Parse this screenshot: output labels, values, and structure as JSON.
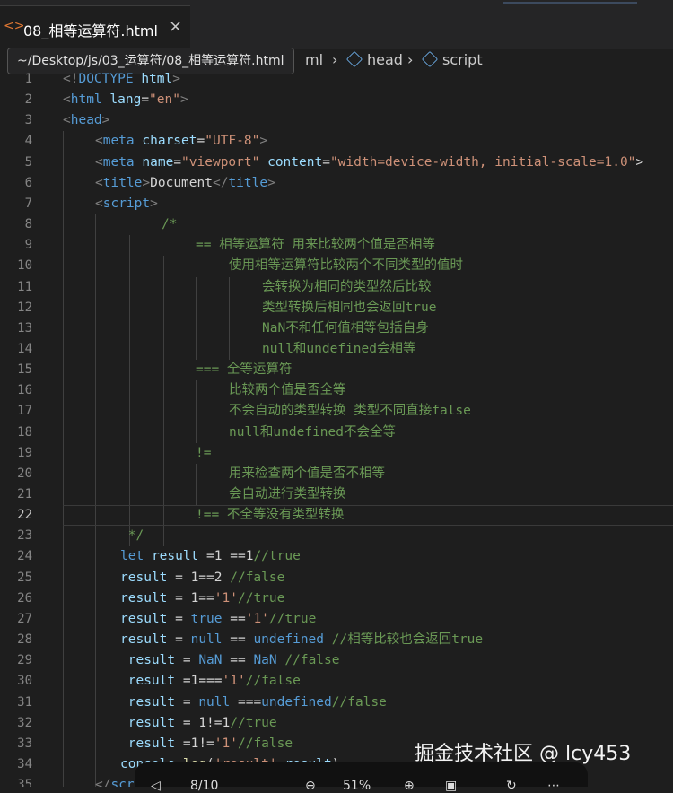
{
  "tab": {
    "icon": "html-icon",
    "title": "08_相等运算符.html",
    "close": "×"
  },
  "tooltip": "~/Desktop/js/03_运算符/08_相等运算符.html",
  "breadcrumb": {
    "partial": "ml",
    "items": [
      "head",
      "script"
    ]
  },
  "editor": {
    "active_line": 22,
    "lines": [
      {
        "n": "1",
        "indent": 0,
        "tokens": [
          [
            "br",
            "<!"
          ],
          [
            "tag",
            "DOCTYPE"
          ],
          [
            "txt",
            " "
          ],
          [
            "attr",
            "html"
          ],
          [
            "br",
            ">"
          ]
        ]
      },
      {
        "n": "2",
        "indent": 0,
        "tokens": [
          [
            "br",
            "<"
          ],
          [
            "tag",
            "html"
          ],
          [
            "txt",
            " "
          ],
          [
            "attr",
            "lang"
          ],
          [
            "txt",
            "="
          ],
          [
            "str",
            "\"en\""
          ],
          [
            "br",
            ">"
          ]
        ]
      },
      {
        "n": "3",
        "indent": 0,
        "tokens": [
          [
            "br",
            "<"
          ],
          [
            "tag",
            "head"
          ],
          [
            "br",
            ">"
          ]
        ]
      },
      {
        "n": "4",
        "indent": 1,
        "tokens": [
          [
            "br",
            "<"
          ],
          [
            "tag",
            "meta"
          ],
          [
            "txt",
            " "
          ],
          [
            "attr",
            "charset"
          ],
          [
            "txt",
            "="
          ],
          [
            "str",
            "\"UTF-8\""
          ],
          [
            "br",
            ">"
          ]
        ]
      },
      {
        "n": "5",
        "indent": 1,
        "tokens": [
          [
            "br",
            "<"
          ],
          [
            "tag",
            "meta"
          ],
          [
            "txt",
            " "
          ],
          [
            "attr",
            "name"
          ],
          [
            "txt",
            "="
          ],
          [
            "str",
            "\"viewport\""
          ],
          [
            "txt",
            " "
          ],
          [
            "attr",
            "content"
          ],
          [
            "txt",
            "="
          ],
          [
            "str",
            "\"width=device-width, initial-scale=1.0\""
          ],
          [
            "txt",
            ">"
          ]
        ]
      },
      {
        "n": "6",
        "indent": 1,
        "tokens": [
          [
            "br",
            "<"
          ],
          [
            "tag",
            "title"
          ],
          [
            "br",
            ">"
          ],
          [
            "txt",
            "Document"
          ],
          [
            "br",
            "</"
          ],
          [
            "tag",
            "title"
          ],
          [
            "br",
            ">"
          ]
        ]
      },
      {
        "n": "7",
        "indent": 1,
        "tokens": [
          [
            "br",
            "<"
          ],
          [
            "tag",
            "script"
          ],
          [
            "br",
            ">"
          ]
        ]
      },
      {
        "n": "8",
        "indent": 3,
        "tokens": [
          [
            "com",
            "/*"
          ]
        ]
      },
      {
        "n": "9",
        "indent": 4,
        "tokens": [
          [
            "com",
            "== 相等运算符 用来比较两个值是否相等"
          ]
        ]
      },
      {
        "n": "10",
        "indent": 5,
        "tokens": [
          [
            "com",
            "使用相等运算符比较两个不同类型的值时"
          ]
        ]
      },
      {
        "n": "11",
        "indent": 6,
        "tokens": [
          [
            "com",
            "会转换为相同的类型然后比较"
          ]
        ]
      },
      {
        "n": "12",
        "indent": 6,
        "tokens": [
          [
            "com",
            "类型转换后相同也会返回true"
          ]
        ]
      },
      {
        "n": "13",
        "indent": 6,
        "tokens": [
          [
            "com",
            "NaN不和任何值相等包括自身"
          ]
        ]
      },
      {
        "n": "14",
        "indent": 6,
        "tokens": [
          [
            "com",
            "null和undefined会相等"
          ]
        ]
      },
      {
        "n": "15",
        "indent": 4,
        "tokens": [
          [
            "com",
            "=== 全等运算符"
          ]
        ]
      },
      {
        "n": "16",
        "indent": 5,
        "tokens": [
          [
            "com",
            "比较两个值是否全等"
          ]
        ]
      },
      {
        "n": "17",
        "indent": 5,
        "tokens": [
          [
            "com",
            "不会自动的类型转换 类型不同直接false"
          ]
        ]
      },
      {
        "n": "18",
        "indent": 5,
        "tokens": [
          [
            "com",
            "null和undefined不会全等"
          ]
        ]
      },
      {
        "n": "19",
        "indent": 4,
        "tokens": [
          [
            "com",
            "!="
          ]
        ]
      },
      {
        "n": "20",
        "indent": 5,
        "tokens": [
          [
            "com",
            "用来检查两个值是否不相等"
          ]
        ]
      },
      {
        "n": "21",
        "indent": 5,
        "tokens": [
          [
            "com",
            "会自动进行类型转换"
          ]
        ]
      },
      {
        "n": "22",
        "indent": 4,
        "tokens": [
          [
            "com",
            "!== 不全等没有类型转换"
          ]
        ]
      },
      {
        "n": "23",
        "indent": 2,
        "tokens": [
          [
            "com",
            " */"
          ]
        ]
      },
      {
        "n": "24",
        "indent": 2,
        "tokens": [
          [
            "kw",
            "let"
          ],
          [
            "txt",
            " "
          ],
          [
            "var",
            "result"
          ],
          [
            "op",
            " =1 ==1"
          ],
          [
            "com",
            "//true"
          ]
        ]
      },
      {
        "n": "25",
        "indent": 2,
        "tokens": [
          [
            "var",
            "result"
          ],
          [
            "op",
            " = 1==2 "
          ],
          [
            "com",
            "//false"
          ]
        ]
      },
      {
        "n": "26",
        "indent": 2,
        "tokens": [
          [
            "var",
            "result"
          ],
          [
            "op",
            " = 1=="
          ],
          [
            "str",
            "'1'"
          ],
          [
            "com",
            "//true"
          ]
        ]
      },
      {
        "n": "27",
        "indent": 2,
        "tokens": [
          [
            "var",
            "result"
          ],
          [
            "op",
            " = "
          ],
          [
            "kw",
            "true"
          ],
          [
            "op",
            " =="
          ],
          [
            "str",
            "'1'"
          ],
          [
            "com",
            "//true"
          ]
        ]
      },
      {
        "n": "28",
        "indent": 2,
        "tokens": [
          [
            "var",
            "result"
          ],
          [
            "op",
            " = "
          ],
          [
            "kw",
            "null"
          ],
          [
            "op",
            " == "
          ],
          [
            "kw",
            "undefined"
          ],
          [
            "op",
            " "
          ],
          [
            "com",
            "//相等比较也会返回true"
          ]
        ]
      },
      {
        "n": "29",
        "indent": 2,
        "tokens": [
          [
            "txt",
            " "
          ],
          [
            "var",
            "result"
          ],
          [
            "op",
            " = "
          ],
          [
            "kw",
            "NaN"
          ],
          [
            "op",
            " == "
          ],
          [
            "kw",
            "NaN"
          ],
          [
            "op",
            " "
          ],
          [
            "com",
            "//false"
          ]
        ]
      },
      {
        "n": "30",
        "indent": 2,
        "tokens": [
          [
            "txt",
            " "
          ],
          [
            "var",
            "result"
          ],
          [
            "op",
            " =1==="
          ],
          [
            "str",
            "'1'"
          ],
          [
            "com",
            "//false"
          ]
        ]
      },
      {
        "n": "31",
        "indent": 2,
        "tokens": [
          [
            "txt",
            " "
          ],
          [
            "var",
            "result"
          ],
          [
            "op",
            " = "
          ],
          [
            "kw",
            "null"
          ],
          [
            "op",
            " ==="
          ],
          [
            "kw",
            "undefined"
          ],
          [
            "com",
            "//false"
          ]
        ]
      },
      {
        "n": "32",
        "indent": 2,
        "tokens": [
          [
            "txt",
            " "
          ],
          [
            "var",
            "result"
          ],
          [
            "op",
            " = 1!=1"
          ],
          [
            "com",
            "//true"
          ]
        ]
      },
      {
        "n": "33",
        "indent": 2,
        "tokens": [
          [
            "txt",
            " "
          ],
          [
            "var",
            "result"
          ],
          [
            "op",
            " =1!="
          ],
          [
            "str",
            "'1'"
          ],
          [
            "com",
            "//false"
          ]
        ]
      },
      {
        "n": "34",
        "indent": 2,
        "tokens": [
          [
            "var",
            "console"
          ],
          [
            "op",
            "."
          ],
          [
            "fn",
            "log"
          ],
          [
            "op",
            "("
          ],
          [
            "str",
            "'result'"
          ],
          [
            "op",
            ","
          ],
          [
            "var",
            "result"
          ],
          [
            "op",
            ")"
          ]
        ]
      },
      {
        "n": "35",
        "indent": 1,
        "tokens": [
          [
            "br",
            "</"
          ],
          [
            "tag",
            "script"
          ],
          [
            "br",
            ">"
          ]
        ]
      }
    ]
  },
  "watermark": "掘金技术社区 @ lcy453",
  "viewer": {
    "page": "8/10",
    "zoom": "51%"
  }
}
